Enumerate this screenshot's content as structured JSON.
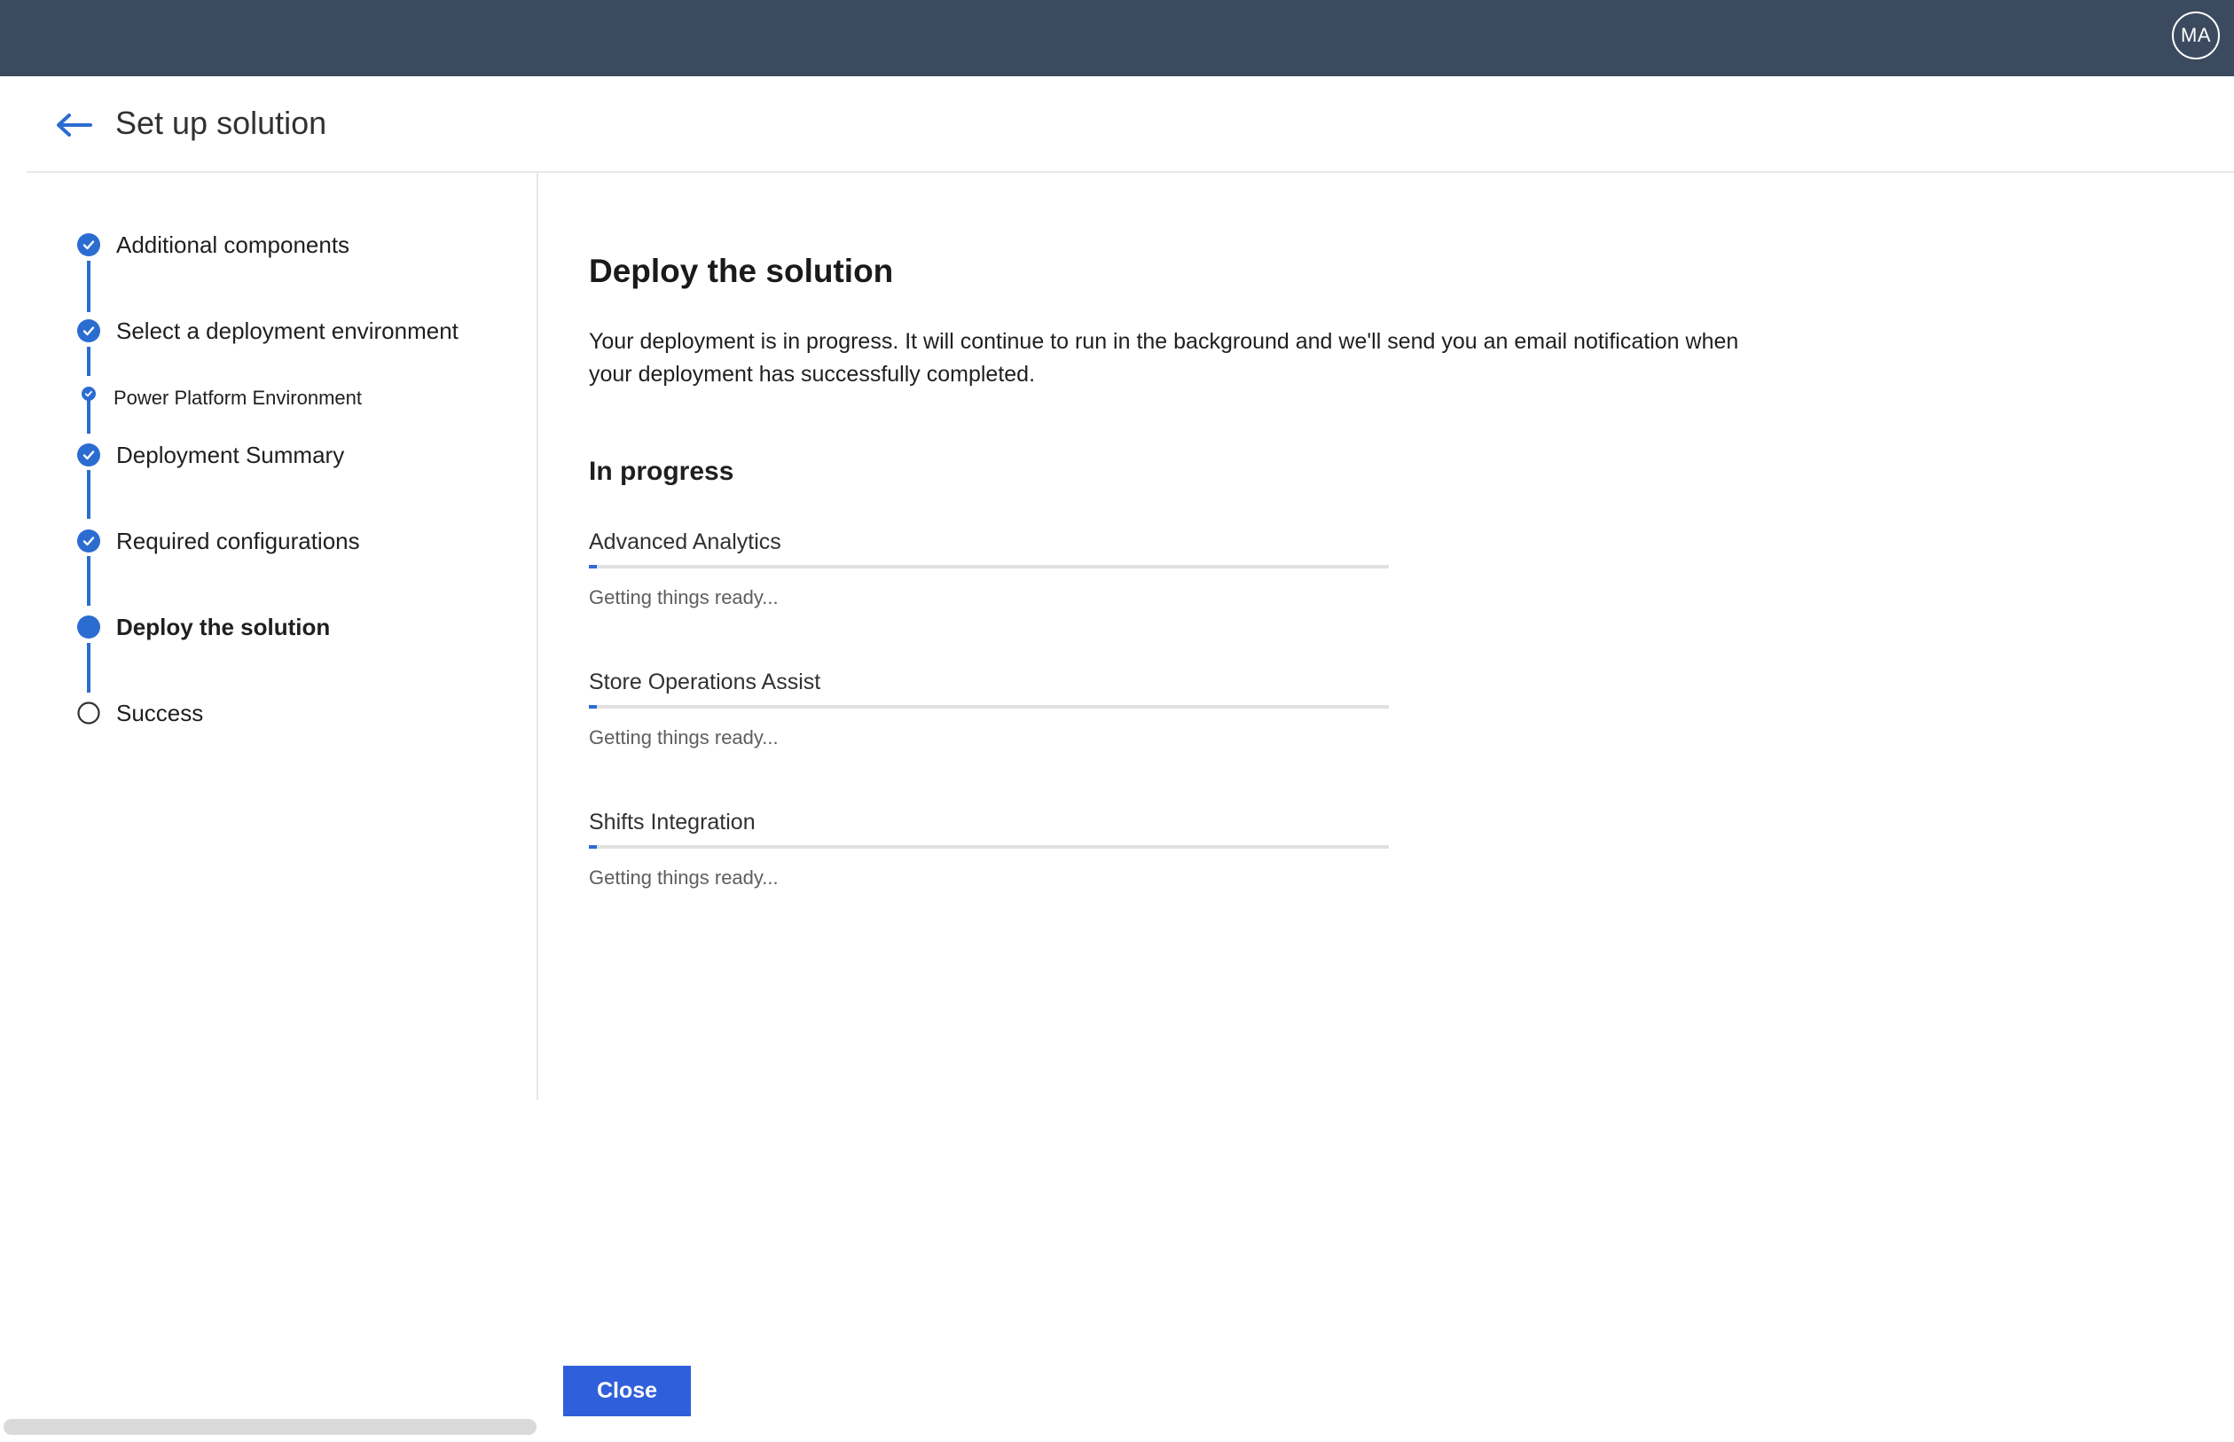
{
  "header": {
    "title": "Set up solution",
    "avatar_initials": "MA"
  },
  "steps": [
    {
      "label": "Additional components",
      "state": "completed"
    },
    {
      "label": "Select a deployment environment",
      "state": "completed"
    },
    {
      "label": "Power Platform Environment",
      "state": "completed",
      "substep": true
    },
    {
      "label": "Deployment Summary",
      "state": "completed"
    },
    {
      "label": "Required configurations",
      "state": "completed"
    },
    {
      "label": "Deploy the solution",
      "state": "current"
    },
    {
      "label": "Success",
      "state": "pending"
    }
  ],
  "main": {
    "title": "Deploy the solution",
    "description": "Your deployment is in progress. It will continue to run in the background and we'll send you an email notification when your deployment has successfully completed.",
    "section_title": "In progress",
    "items": [
      {
        "name": "Advanced Analytics",
        "status": "Getting things ready...",
        "progress": 0.01
      },
      {
        "name": "Store Operations Assist",
        "status": "Getting things ready...",
        "progress": 0.01
      },
      {
        "name": "Shifts Integration",
        "status": "Getting things ready...",
        "progress": 0.01
      }
    ]
  },
  "footer": {
    "close_label": "Close"
  },
  "colors": {
    "topbar": "#3b4a5f",
    "accent": "#2b6cd1",
    "primary_button": "#2f5fda"
  }
}
